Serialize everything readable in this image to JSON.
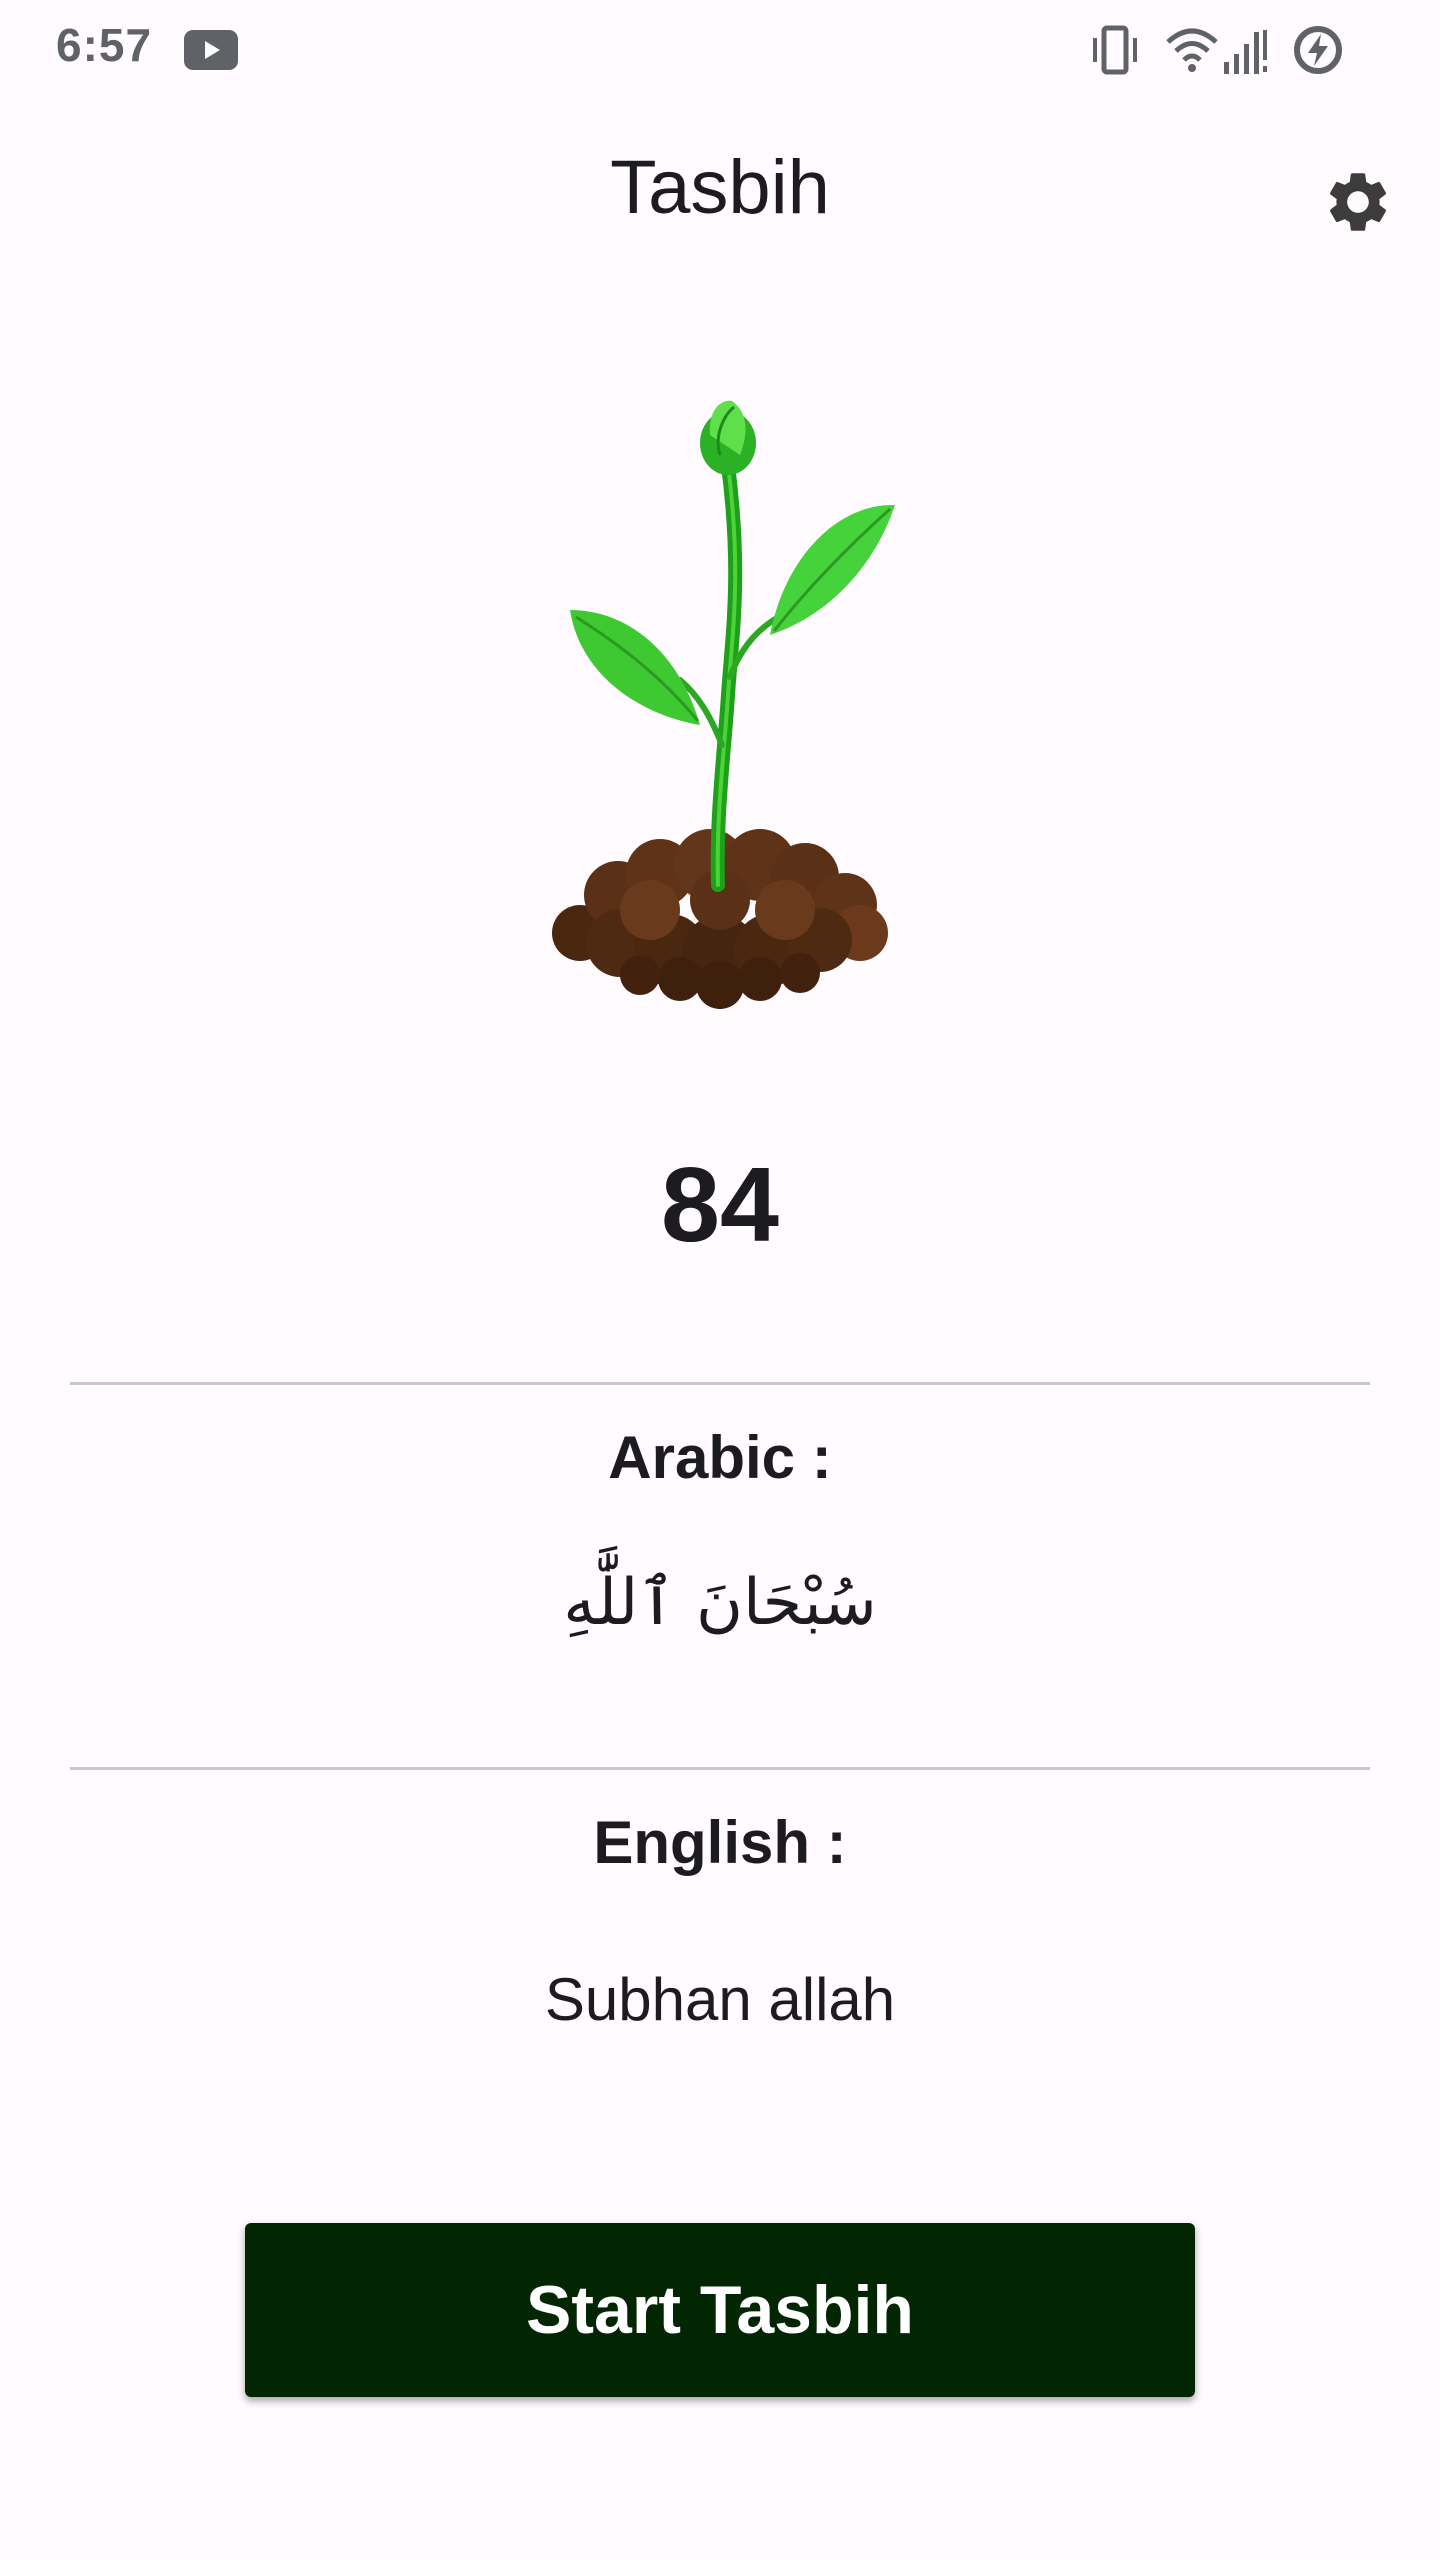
{
  "status_bar": {
    "time": "6:57",
    "icons": [
      "youtube-icon",
      "vibrate-icon",
      "wifi-icon",
      "signal-icon",
      "battery-saver-icon"
    ]
  },
  "app_bar": {
    "title": "Tasbih",
    "settings_icon": "gear-icon"
  },
  "counter": {
    "value": "84"
  },
  "arabic": {
    "label": "Arabic :",
    "text": "سُبْحَانَ ٱللَّٰهِ"
  },
  "english": {
    "label": "English :",
    "text": "Subhan allah"
  },
  "actions": {
    "start_label": "Start Tasbih"
  },
  "colors": {
    "background": "#fffbfe",
    "button": "#022502",
    "divider": "#cac4d0",
    "status_icons": "#5f6368"
  }
}
